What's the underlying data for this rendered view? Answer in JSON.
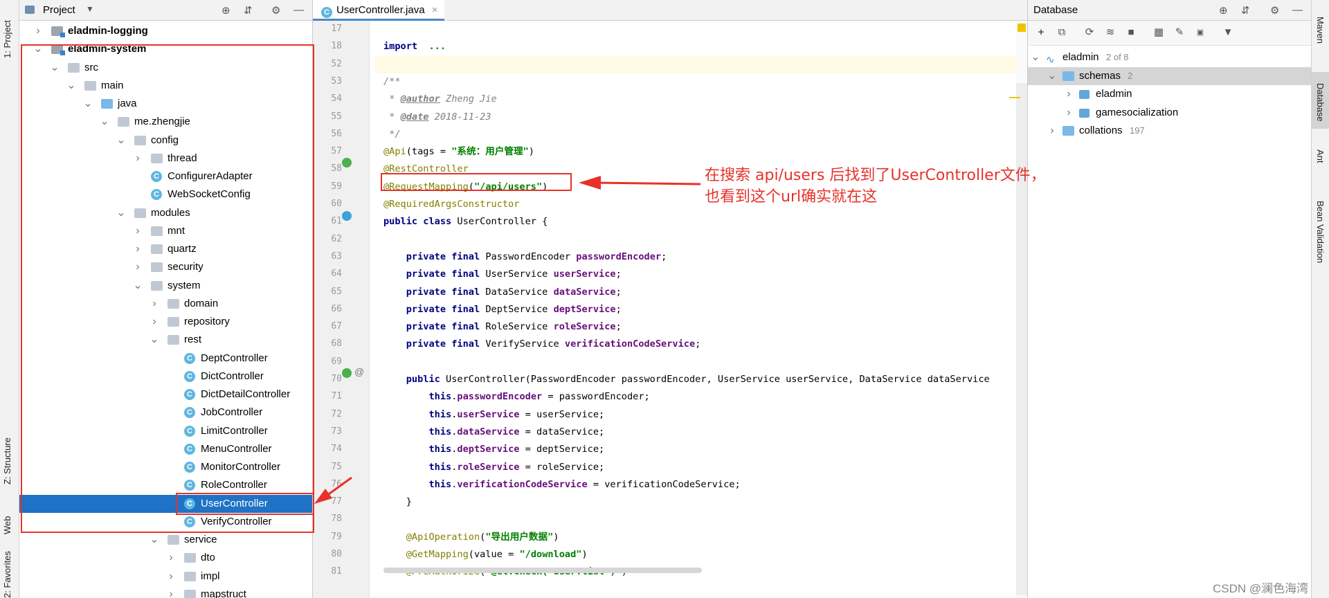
{
  "left_strip": {
    "project": "1: Project",
    "structure": "Z: Structure",
    "web": "Web",
    "favorites": "2: Favorites"
  },
  "project": {
    "title": "Project",
    "tree": [
      {
        "label": "eladmin-logging",
        "kind": "module",
        "depth": 1,
        "arrow": "▸",
        "bold": true
      },
      {
        "label": "eladmin-system",
        "kind": "module",
        "depth": 1,
        "arrow": "▾",
        "bold": true
      },
      {
        "label": "src",
        "kind": "folder",
        "depth": 2,
        "arrow": "▾"
      },
      {
        "label": "main",
        "kind": "folder",
        "depth": 3,
        "arrow": "▾"
      },
      {
        "label": "java",
        "kind": "src",
        "depth": 4,
        "arrow": "▾"
      },
      {
        "label": "me.zhengjie",
        "kind": "folder",
        "depth": 5,
        "arrow": "▾"
      },
      {
        "label": "config",
        "kind": "folder",
        "depth": 6,
        "arrow": "▾"
      },
      {
        "label": "thread",
        "kind": "folder",
        "depth": 7,
        "arrow": "▸"
      },
      {
        "label": "ConfigurerAdapter",
        "kind": "class",
        "depth": 7
      },
      {
        "label": "WebSocketConfig",
        "kind": "class",
        "depth": 7
      },
      {
        "label": "modules",
        "kind": "folder",
        "depth": 6,
        "arrow": "▾"
      },
      {
        "label": "mnt",
        "kind": "folder",
        "depth": 7,
        "arrow": "▸"
      },
      {
        "label": "quartz",
        "kind": "folder",
        "depth": 7,
        "arrow": "▸"
      },
      {
        "label": "security",
        "kind": "folder",
        "depth": 7,
        "arrow": "▸"
      },
      {
        "label": "system",
        "kind": "folder",
        "depth": 7,
        "arrow": "▾"
      },
      {
        "label": "domain",
        "kind": "folder",
        "depth": 8,
        "arrow": "▸"
      },
      {
        "label": "repository",
        "kind": "folder",
        "depth": 8,
        "arrow": "▸"
      },
      {
        "label": "rest",
        "kind": "folder",
        "depth": 8,
        "arrow": "▾"
      },
      {
        "label": "DeptController",
        "kind": "class",
        "depth": 9
      },
      {
        "label": "DictController",
        "kind": "class",
        "depth": 9
      },
      {
        "label": "DictDetailController",
        "kind": "class",
        "depth": 9
      },
      {
        "label": "JobController",
        "kind": "class",
        "depth": 9
      },
      {
        "label": "LimitController",
        "kind": "class",
        "depth": 9
      },
      {
        "label": "MenuController",
        "kind": "class",
        "depth": 9
      },
      {
        "label": "MonitorController",
        "kind": "class",
        "depth": 9
      },
      {
        "label": "RoleController",
        "kind": "class",
        "depth": 9
      },
      {
        "label": "UserController",
        "kind": "class",
        "depth": 9,
        "selected": true
      },
      {
        "label": "VerifyController",
        "kind": "class",
        "depth": 9
      },
      {
        "label": "service",
        "kind": "folder",
        "depth": 8,
        "arrow": "▾"
      },
      {
        "label": "dto",
        "kind": "folder",
        "depth": 9,
        "arrow": "▸"
      },
      {
        "label": "impl",
        "kind": "folder",
        "depth": 9,
        "arrow": "▸"
      },
      {
        "label": "mapstruct",
        "kind": "folder",
        "depth": 9,
        "arrow": "▸"
      }
    ]
  },
  "editor": {
    "tab_label": "UserController.java",
    "lines": [
      {
        "n": "17",
        "t": []
      },
      {
        "n": "18",
        "t": [
          [
            "kw",
            "import"
          ],
          [
            "",
            "  "
          ],
          [
            "st",
            "..."
          ]
        ]
      },
      {
        "n": "52",
        "t": [],
        "current": true
      },
      {
        "n": "53",
        "t": [
          [
            "cm",
            "/**"
          ]
        ]
      },
      {
        "n": "54",
        "t": [
          [
            "cm",
            " * "
          ],
          [
            "tag",
            "@author"
          ],
          [
            "cm",
            " Zheng Jie"
          ]
        ]
      },
      {
        "n": "55",
        "t": [
          [
            "cm",
            " * "
          ],
          [
            "tag",
            "@date"
          ],
          [
            "cm",
            " 2018-11-23"
          ]
        ]
      },
      {
        "n": "56",
        "t": [
          [
            "cm",
            " */"
          ]
        ]
      },
      {
        "n": "57",
        "t": [
          [
            "an",
            "@Api"
          ],
          [
            "",
            "(tags = "
          ],
          [
            "st",
            "\"系统：用户管理\""
          ],
          [
            "",
            ")"
          ]
        ]
      },
      {
        "n": "58",
        "t": [
          [
            "an",
            "@RestController"
          ]
        ]
      },
      {
        "n": "59",
        "t": [
          [
            "an",
            "@RequestMapping"
          ],
          [
            "",
            "("
          ],
          [
            "st",
            "\"/api/users\""
          ],
          [
            "",
            ")"
          ]
        ]
      },
      {
        "n": "60",
        "t": [
          [
            "an",
            "@RequiredArgsConstructor"
          ]
        ]
      },
      {
        "n": "61",
        "t": [
          [
            "kw",
            "public class"
          ],
          [
            "",
            " UserController {"
          ]
        ]
      },
      {
        "n": "62",
        "t": []
      },
      {
        "n": "63",
        "t": [
          [
            "",
            "    "
          ],
          [
            "kw",
            "private final"
          ],
          [
            "",
            " PasswordEncoder "
          ],
          [
            "fd",
            "passwordEncoder"
          ],
          [
            "",
            ";"
          ]
        ]
      },
      {
        "n": "64",
        "t": [
          [
            "",
            "    "
          ],
          [
            "kw",
            "private final"
          ],
          [
            "",
            " UserService "
          ],
          [
            "fd",
            "userService"
          ],
          [
            "",
            ";"
          ]
        ]
      },
      {
        "n": "65",
        "t": [
          [
            "",
            "    "
          ],
          [
            "kw",
            "private final"
          ],
          [
            "",
            " DataService "
          ],
          [
            "fd",
            "dataService"
          ],
          [
            "",
            ";"
          ]
        ]
      },
      {
        "n": "66",
        "t": [
          [
            "",
            "    "
          ],
          [
            "kw",
            "private final"
          ],
          [
            "",
            " DeptService "
          ],
          [
            "fd",
            "deptService"
          ],
          [
            "",
            ";"
          ]
        ]
      },
      {
        "n": "67",
        "t": [
          [
            "",
            "    "
          ],
          [
            "kw",
            "private final"
          ],
          [
            "",
            " RoleService "
          ],
          [
            "fd",
            "roleService"
          ],
          [
            "",
            ";"
          ]
        ]
      },
      {
        "n": "68",
        "t": [
          [
            "",
            "    "
          ],
          [
            "kw",
            "private final"
          ],
          [
            "",
            " VerifyService "
          ],
          [
            "fd",
            "verificationCodeService"
          ],
          [
            "",
            ";"
          ]
        ]
      },
      {
        "n": "69",
        "t": []
      },
      {
        "n": "70",
        "t": [
          [
            "",
            "    "
          ],
          [
            "kw",
            "public"
          ],
          [
            "",
            " UserController(PasswordEncoder passwordEncoder, UserService userService, DataService dataService"
          ]
        ]
      },
      {
        "n": "71",
        "t": [
          [
            "",
            "        "
          ],
          [
            "kw",
            "this"
          ],
          [
            "",
            "."
          ],
          [
            "fd",
            "passwordEncoder"
          ],
          [
            "",
            " = passwordEncoder;"
          ]
        ]
      },
      {
        "n": "72",
        "t": [
          [
            "",
            "        "
          ],
          [
            "kw",
            "this"
          ],
          [
            "",
            "."
          ],
          [
            "fd",
            "userService"
          ],
          [
            "",
            " = userService;"
          ]
        ]
      },
      {
        "n": "73",
        "t": [
          [
            "",
            "        "
          ],
          [
            "kw",
            "this"
          ],
          [
            "",
            "."
          ],
          [
            "fd",
            "dataService"
          ],
          [
            "",
            " = dataService;"
          ]
        ]
      },
      {
        "n": "74",
        "t": [
          [
            "",
            "        "
          ],
          [
            "kw",
            "this"
          ],
          [
            "",
            "."
          ],
          [
            "fd",
            "deptService"
          ],
          [
            "",
            " = deptService;"
          ]
        ]
      },
      {
        "n": "75",
        "t": [
          [
            "",
            "        "
          ],
          [
            "kw",
            "this"
          ],
          [
            "",
            "."
          ],
          [
            "fd",
            "roleService"
          ],
          [
            "",
            " = roleService;"
          ]
        ]
      },
      {
        "n": "76",
        "t": [
          [
            "",
            "        "
          ],
          [
            "kw",
            "this"
          ],
          [
            "",
            "."
          ],
          [
            "fd",
            "verificationCodeService"
          ],
          [
            "",
            " = verificationCodeService;"
          ]
        ]
      },
      {
        "n": "77",
        "t": [
          [
            "",
            "    }"
          ]
        ]
      },
      {
        "n": "78",
        "t": []
      },
      {
        "n": "79",
        "t": [
          [
            "",
            "    "
          ],
          [
            "an",
            "@ApiOperation"
          ],
          [
            "",
            "("
          ],
          [
            "st",
            "\"导出用户数据\""
          ],
          [
            "",
            ")"
          ]
        ]
      },
      {
        "n": "80",
        "t": [
          [
            "",
            "    "
          ],
          [
            "an",
            "@GetMapping"
          ],
          [
            "",
            "(value = "
          ],
          [
            "st",
            "\"/download\""
          ],
          [
            "",
            ")"
          ]
        ]
      },
      {
        "n": "81",
        "t": [
          [
            "",
            "    "
          ],
          [
            "an",
            "@PreAuthorize"
          ],
          [
            "",
            "("
          ],
          [
            "st",
            "\"@el.check("
          ],
          [
            "st",
            "'user:list'"
          ],
          [
            "st",
            ")\""
          ],
          [
            "",
            ")"
          ]
        ]
      }
    ]
  },
  "database": {
    "title": "Database",
    "tree": [
      {
        "label": "eladmin",
        "count": "2 of 8",
        "depth": 0,
        "arrow": "▾",
        "icon": "datasource"
      },
      {
        "label": "schemas",
        "count": "2",
        "depth": 1,
        "arrow": "▾",
        "icon": "folder",
        "highlight": true
      },
      {
        "label": "eladmin",
        "depth": 2,
        "arrow": "▸",
        "icon": "schema"
      },
      {
        "label": "gamesocialization",
        "depth": 2,
        "arrow": "▸",
        "icon": "schema"
      },
      {
        "label": "collations",
        "count": "197",
        "depth": 1,
        "arrow": "▸",
        "icon": "folder"
      }
    ]
  },
  "right_strip": {
    "maven": "Maven",
    "database": "Database",
    "ant": "Ant",
    "bean_validation": "Bean Validation"
  },
  "annotation": {
    "line1": "在搜索 api/users 后找到了UserController文件，",
    "line2": "也看到这个url确实就在这",
    "color": "#e8312a"
  },
  "watermark": "CSDN @澜色海湾"
}
